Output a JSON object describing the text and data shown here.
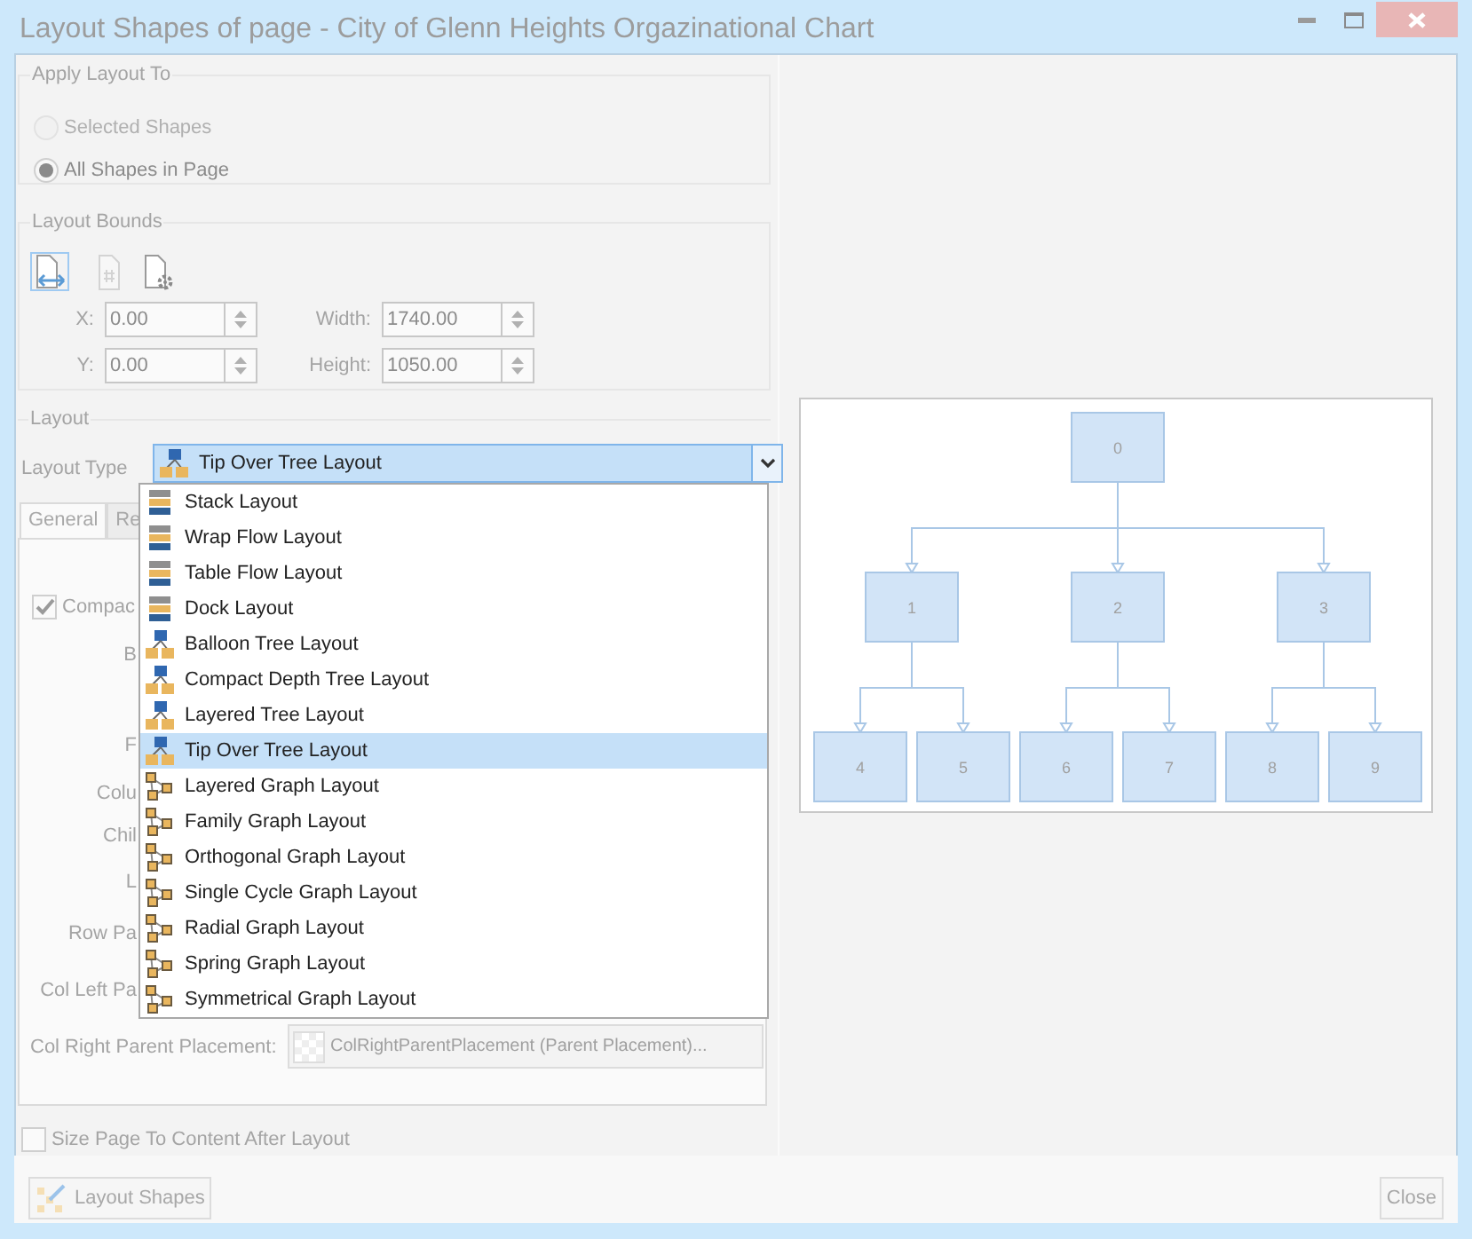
{
  "window": {
    "title": "Layout Shapes of page - City of Glenn Heights Orgazinational Chart"
  },
  "apply_layout_to": {
    "title": "Apply Layout To",
    "options": [
      {
        "label": "Selected Shapes",
        "selected": false,
        "disabled": true
      },
      {
        "label": "All Shapes in Page",
        "selected": true,
        "disabled": false
      }
    ]
  },
  "layout_bounds": {
    "title": "Layout Bounds",
    "modes": [
      {
        "kind": "page-arrows",
        "selected": true,
        "disabled": false
      },
      {
        "kind": "page-hash",
        "selected": false,
        "disabled": true
      },
      {
        "kind": "page-gear",
        "selected": false,
        "disabled": false
      }
    ],
    "fields": [
      {
        "label": "X:",
        "value": "0.00"
      },
      {
        "label": "Width:",
        "value": "1740.00"
      },
      {
        "label": "Y:",
        "value": "0.00"
      },
      {
        "label": "Height:",
        "value": "1050.00"
      }
    ]
  },
  "layout": {
    "title": "Layout",
    "type_label": "Layout Type",
    "combo": {
      "value": "Tip Over Tree Layout",
      "kind": "tree",
      "expanded": true
    },
    "options": [
      {
        "label": "Stack Layout",
        "kind": "stack",
        "selected": false
      },
      {
        "label": "Wrap Flow Layout",
        "kind": "stack",
        "selected": false
      },
      {
        "label": "Table Flow Layout",
        "kind": "stack",
        "selected": false
      },
      {
        "label": "Dock Layout",
        "kind": "stack",
        "selected": false
      },
      {
        "label": "Balloon Tree Layout",
        "kind": "tree",
        "selected": false
      },
      {
        "label": "Compact Depth Tree Layout",
        "kind": "tree",
        "selected": false
      },
      {
        "label": "Layered Tree Layout",
        "kind": "tree",
        "selected": false
      },
      {
        "label": "Tip Over Tree Layout",
        "kind": "tree",
        "selected": true
      },
      {
        "label": "Layered Graph Layout",
        "kind": "graph",
        "selected": false
      },
      {
        "label": "Family Graph Layout",
        "kind": "graph",
        "selected": false
      },
      {
        "label": "Orthogonal Graph Layout",
        "kind": "graph",
        "selected": false
      },
      {
        "label": "Single Cycle Graph Layout",
        "kind": "graph",
        "selected": false
      },
      {
        "label": "Radial Graph Layout",
        "kind": "graph",
        "selected": false
      },
      {
        "label": "Spring Graph Layout",
        "kind": "graph",
        "selected": false
      },
      {
        "label": "Symmetrical Graph Layout",
        "kind": "graph",
        "selected": false
      }
    ],
    "tabs": [
      {
        "label": "General",
        "selected": true
      },
      {
        "label": "Re",
        "selected": false
      }
    ],
    "compact_checkbox": {
      "label": "Compac",
      "checked": true
    },
    "property_labels": [
      "B",
      "F",
      "Colu",
      "Chil",
      "L",
      "Row Pa",
      "Col Left Pa"
    ],
    "col_right": {
      "label": "Col Right Parent Placement:",
      "value": "ColRightParentPlacement (Parent Placement)..."
    }
  },
  "size_page_checkbox": {
    "label": "Size Page To Content After Layout",
    "checked": false
  },
  "preview": {
    "nodes": [
      {
        "label": "0",
        "children": [
          {
            "label": "1",
            "children": [
              {
                "label": "4"
              },
              {
                "label": "5"
              }
            ]
          },
          {
            "label": "2",
            "children": [
              {
                "label": "6"
              },
              {
                "label": "7"
              }
            ]
          },
          {
            "label": "3",
            "children": [
              {
                "label": "8"
              },
              {
                "label": "9"
              }
            ]
          }
        ]
      }
    ]
  },
  "buttons": [
    {
      "label": "Layout Shapes",
      "kind": "layout"
    },
    {
      "label": "Close",
      "kind": "close"
    }
  ]
}
